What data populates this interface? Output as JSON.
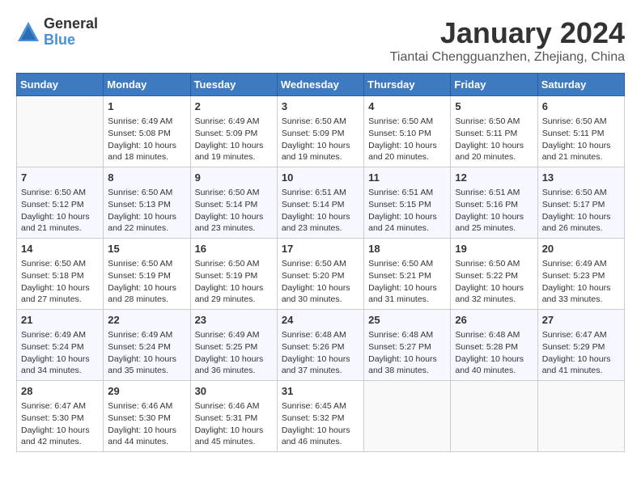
{
  "logo": {
    "general": "General",
    "blue": "Blue"
  },
  "title": "January 2024",
  "subtitle": "Tiantai Chengguanzhen, Zhejiang, China",
  "headers": [
    "Sunday",
    "Monday",
    "Tuesday",
    "Wednesday",
    "Thursday",
    "Friday",
    "Saturday"
  ],
  "weeks": [
    [
      {
        "day": "",
        "info": ""
      },
      {
        "day": "1",
        "info": "Sunrise: 6:49 AM\nSunset: 5:08 PM\nDaylight: 10 hours\nand 18 minutes."
      },
      {
        "day": "2",
        "info": "Sunrise: 6:49 AM\nSunset: 5:09 PM\nDaylight: 10 hours\nand 19 minutes."
      },
      {
        "day": "3",
        "info": "Sunrise: 6:50 AM\nSunset: 5:09 PM\nDaylight: 10 hours\nand 19 minutes."
      },
      {
        "day": "4",
        "info": "Sunrise: 6:50 AM\nSunset: 5:10 PM\nDaylight: 10 hours\nand 20 minutes."
      },
      {
        "day": "5",
        "info": "Sunrise: 6:50 AM\nSunset: 5:11 PM\nDaylight: 10 hours\nand 20 minutes."
      },
      {
        "day": "6",
        "info": "Sunrise: 6:50 AM\nSunset: 5:11 PM\nDaylight: 10 hours\nand 21 minutes."
      }
    ],
    [
      {
        "day": "7",
        "info": "Sunrise: 6:50 AM\nSunset: 5:12 PM\nDaylight: 10 hours\nand 21 minutes."
      },
      {
        "day": "8",
        "info": "Sunrise: 6:50 AM\nSunset: 5:13 PM\nDaylight: 10 hours\nand 22 minutes."
      },
      {
        "day": "9",
        "info": "Sunrise: 6:50 AM\nSunset: 5:14 PM\nDaylight: 10 hours\nand 23 minutes."
      },
      {
        "day": "10",
        "info": "Sunrise: 6:51 AM\nSunset: 5:14 PM\nDaylight: 10 hours\nand 23 minutes."
      },
      {
        "day": "11",
        "info": "Sunrise: 6:51 AM\nSunset: 5:15 PM\nDaylight: 10 hours\nand 24 minutes."
      },
      {
        "day": "12",
        "info": "Sunrise: 6:51 AM\nSunset: 5:16 PM\nDaylight: 10 hours\nand 25 minutes."
      },
      {
        "day": "13",
        "info": "Sunrise: 6:50 AM\nSunset: 5:17 PM\nDaylight: 10 hours\nand 26 minutes."
      }
    ],
    [
      {
        "day": "14",
        "info": "Sunrise: 6:50 AM\nSunset: 5:18 PM\nDaylight: 10 hours\nand 27 minutes."
      },
      {
        "day": "15",
        "info": "Sunrise: 6:50 AM\nSunset: 5:19 PM\nDaylight: 10 hours\nand 28 minutes."
      },
      {
        "day": "16",
        "info": "Sunrise: 6:50 AM\nSunset: 5:19 PM\nDaylight: 10 hours\nand 29 minutes."
      },
      {
        "day": "17",
        "info": "Sunrise: 6:50 AM\nSunset: 5:20 PM\nDaylight: 10 hours\nand 30 minutes."
      },
      {
        "day": "18",
        "info": "Sunrise: 6:50 AM\nSunset: 5:21 PM\nDaylight: 10 hours\nand 31 minutes."
      },
      {
        "day": "19",
        "info": "Sunrise: 6:50 AM\nSunset: 5:22 PM\nDaylight: 10 hours\nand 32 minutes."
      },
      {
        "day": "20",
        "info": "Sunrise: 6:49 AM\nSunset: 5:23 PM\nDaylight: 10 hours\nand 33 minutes."
      }
    ],
    [
      {
        "day": "21",
        "info": "Sunrise: 6:49 AM\nSunset: 5:24 PM\nDaylight: 10 hours\nand 34 minutes."
      },
      {
        "day": "22",
        "info": "Sunrise: 6:49 AM\nSunset: 5:24 PM\nDaylight: 10 hours\nand 35 minutes."
      },
      {
        "day": "23",
        "info": "Sunrise: 6:49 AM\nSunset: 5:25 PM\nDaylight: 10 hours\nand 36 minutes."
      },
      {
        "day": "24",
        "info": "Sunrise: 6:48 AM\nSunset: 5:26 PM\nDaylight: 10 hours\nand 37 minutes."
      },
      {
        "day": "25",
        "info": "Sunrise: 6:48 AM\nSunset: 5:27 PM\nDaylight: 10 hours\nand 38 minutes."
      },
      {
        "day": "26",
        "info": "Sunrise: 6:48 AM\nSunset: 5:28 PM\nDaylight: 10 hours\nand 40 minutes."
      },
      {
        "day": "27",
        "info": "Sunrise: 6:47 AM\nSunset: 5:29 PM\nDaylight: 10 hours\nand 41 minutes."
      }
    ],
    [
      {
        "day": "28",
        "info": "Sunrise: 6:47 AM\nSunset: 5:30 PM\nDaylight: 10 hours\nand 42 minutes."
      },
      {
        "day": "29",
        "info": "Sunrise: 6:46 AM\nSunset: 5:30 PM\nDaylight: 10 hours\nand 44 minutes."
      },
      {
        "day": "30",
        "info": "Sunrise: 6:46 AM\nSunset: 5:31 PM\nDaylight: 10 hours\nand 45 minutes."
      },
      {
        "day": "31",
        "info": "Sunrise: 6:45 AM\nSunset: 5:32 PM\nDaylight: 10 hours\nand 46 minutes."
      },
      {
        "day": "",
        "info": ""
      },
      {
        "day": "",
        "info": ""
      },
      {
        "day": "",
        "info": ""
      }
    ]
  ]
}
